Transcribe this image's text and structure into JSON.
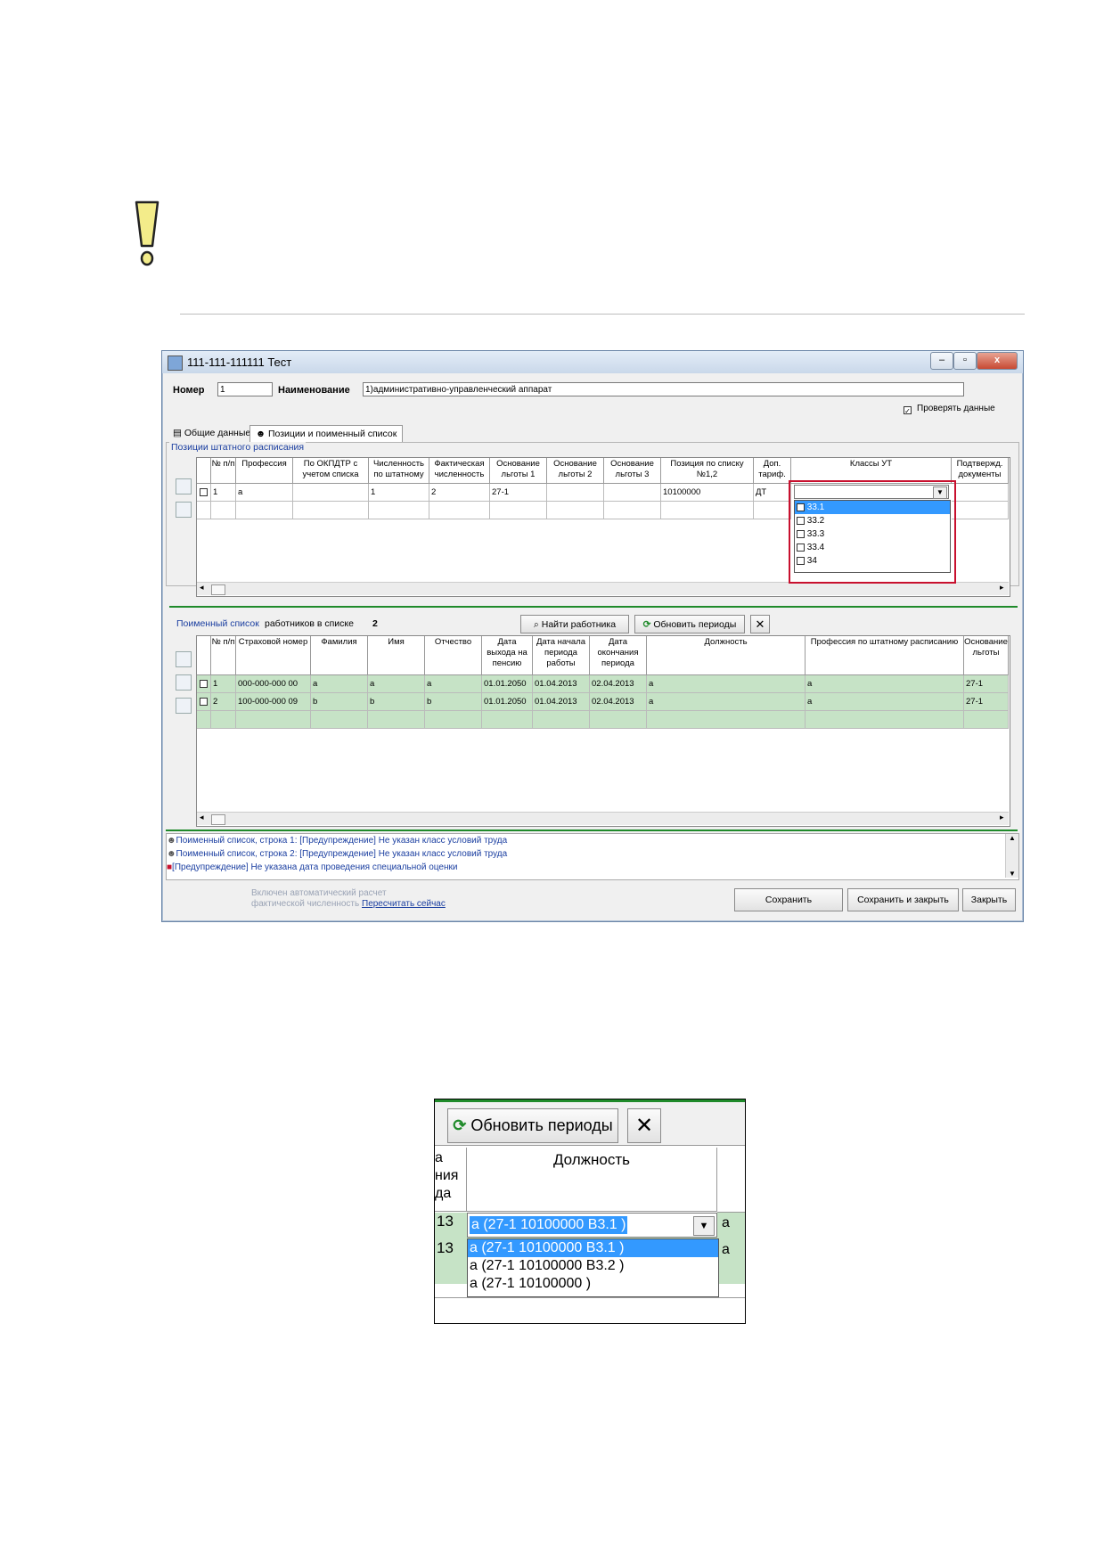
{
  "window": {
    "title": "111-111-111111 Тест",
    "number_label": "Номер",
    "number_value": "1",
    "name_label": "Наименование",
    "name_value": "1)административно-управленческий аппарат",
    "check_data_label": "Проверять данные",
    "buttons": {
      "minimize": "–",
      "maximize": "▫",
      "close": "x"
    }
  },
  "tabs": [
    "Общие данные",
    "Позиции и поименный список"
  ],
  "positions": {
    "title": "Позиции штатного расписания",
    "columns": [
      "№ п/п",
      "Профессия",
      "По ОКПДТР с учетом списка",
      "Численность по штатному",
      "Фактическая численность",
      "Основание льготы 1",
      "Основание льготы 2",
      "Основание льготы 3",
      "Позиция по списку №1,2",
      "Доп. тариф.",
      "Классы УТ",
      "Подтвержд. документы"
    ],
    "rows": [
      [
        "1",
        "а",
        "",
        "1",
        "2",
        "27-1",
        "",
        "",
        "10100000",
        "ДТ",
        "",
        ""
      ]
    ],
    "classes_options": [
      "33.1",
      "33.2",
      "33.3",
      "33.4",
      "34"
    ]
  },
  "workers": {
    "title": "Поименный список",
    "count_label": "работников в списке",
    "count_value": "2",
    "find_button": "Найти работника",
    "refresh_button": "Обновить периоды",
    "clear_button": "✕",
    "columns": [
      "№ п/п",
      "Страховой номер",
      "Фамилия",
      "Имя",
      "Отчество",
      "Дата выхода на пенсию",
      "Дата начала периода работы",
      "Дата окончания периода",
      "Должность",
      "Профессия по штатному расписанию",
      "Основание льготы"
    ],
    "rows": [
      [
        "1",
        "000-000-000 00",
        "a",
        "a",
        "a",
        "01.01.2050",
        "01.04.2013",
        "02.04.2013",
        "a",
        "a",
        "27-1"
      ],
      [
        "2",
        "100-000-000 09",
        "b",
        "b",
        "b",
        "01.01.2050",
        "01.04.2013",
        "02.04.2013",
        "a",
        "a",
        "27-1"
      ]
    ]
  },
  "log": [
    "Поименный список, строка 1: [Предупреждение]  Не указан класс условий труда",
    "Поименный список, строка 2: [Предупреждение]  Не указан класс условий труда",
    "[Предупреждение]  Не указана дата проведения специальной оценки"
  ],
  "footer": {
    "auto_calc_line1": "Включен автоматический расчет",
    "auto_calc_line2": "фактической численность",
    "recalc_link": "Пересчитать сейчас",
    "save": "Сохранить",
    "save_close": "Сохранить и закрыть",
    "close": "Закрыть"
  },
  "zoom": {
    "refresh_button": "Обновить периоды",
    "clear_button": "✕",
    "left_header": [
      "а",
      "ния",
      "да"
    ],
    "position_header": "Должность",
    "row_left": [
      "13",
      "13"
    ],
    "row_right": [
      "а",
      "а"
    ],
    "select_value": "а (27-1  10100000 В3.1 )",
    "options": [
      "а (27-1  10100000 В3.1 )",
      "а (27-1  10100000 В3.2 )",
      "а (27-1  10100000   )"
    ]
  },
  "colors": {
    "accent": "#1a3ea0",
    "highlight": "#c8102e",
    "row_green": "#c6e3c6",
    "warning": "#f3ec8a"
  }
}
